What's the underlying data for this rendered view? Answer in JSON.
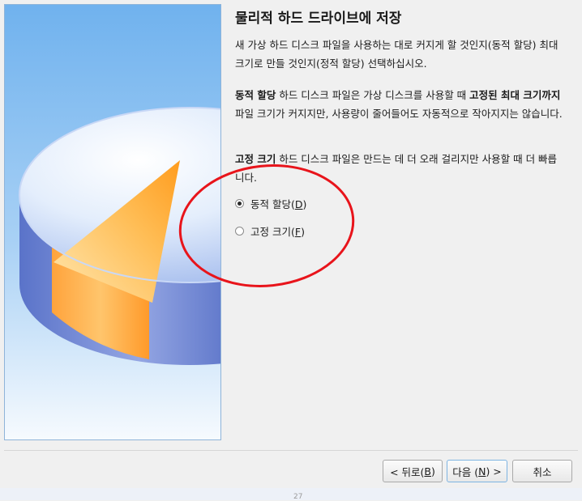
{
  "page": {
    "title": "물리적 하드 드라이브에 저장",
    "description": "새 가상 하드 디스크 파일을 사용하는 대로 커지게 할 것인지(동적 할당) 최대 크기로 만들 것인지(정적 할당) 선택하십시오.",
    "dynamic_info": {
      "bold1": "동적 할당",
      "text1": " 하드 디스크 파일은 가상 디스크를 사용할 때 ",
      "bold2": "고정된 최대 크기까지",
      "text2": " 파일 크기가 커지지만, 사용량이 줄어들어도 자동적으로 작아지지는 않습니다."
    },
    "fixed_info": {
      "bold": "고정 크기",
      "text": " 하드 디스크 파일은 만드는 데 더 오래 걸리지만 사용할 때 더 빠릅니다."
    }
  },
  "options": [
    {
      "label": "동적 할당(",
      "mnemonic": "D",
      "suffix": ")",
      "selected": true
    },
    {
      "label": "고정 크기(",
      "mnemonic": "F",
      "suffix": ")",
      "selected": false
    }
  ],
  "buttons": {
    "back": {
      "prefix": "< 뒤로(",
      "mnemonic": "B",
      "suffix": ")"
    },
    "next": {
      "prefix": "다음 (",
      "mnemonic": "N",
      "suffix": ") >"
    },
    "cancel": "취소"
  },
  "footer": {
    "page_number": "27"
  },
  "colors": {
    "annotation": "#e8141b",
    "accent": "#7eb4e2"
  },
  "icons": {
    "illustration": "hard-disk-pie-icon"
  }
}
